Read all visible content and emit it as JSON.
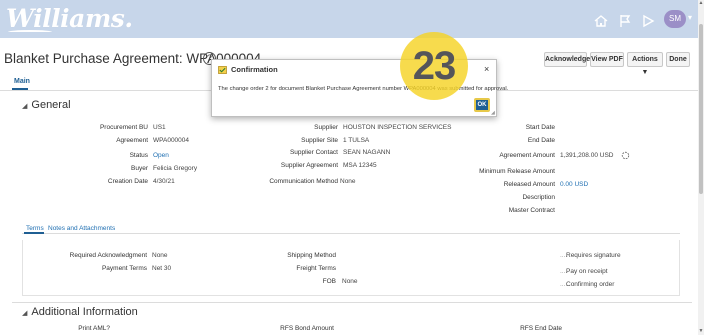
{
  "app": {
    "logo": "Williams.",
    "user_initials": "SM"
  },
  "page": {
    "title": "Blanket Purchase Agreement: WPA000004",
    "buttons": {
      "acknowledge": "Acknowledge",
      "view_pdf": "View PDF",
      "actions": "Actions ▼",
      "done": "Done"
    },
    "main_tab": "Main"
  },
  "general": {
    "title": "General",
    "left": [
      {
        "label": "Procurement BU",
        "value": "US1"
      },
      {
        "label": "Agreement",
        "value": "WPA000004"
      },
      {
        "label": "Status",
        "value": "Open"
      },
      {
        "label": "Buyer",
        "value": "Felicia Gregory"
      },
      {
        "label": "Creation Date",
        "value": "4/30/21"
      }
    ],
    "middle": [
      {
        "label": "Supplier",
        "value": "HOUSTON INSPECTION SERVICES"
      },
      {
        "label": "Supplier Site",
        "value": "1 TULSA"
      },
      {
        "label": "Supplier Contact",
        "value": "SEAN NAGANN"
      },
      {
        "label": "Supplier Agreement",
        "value": "MSA 12345"
      },
      {
        "label": "Communication Method",
        "value": "None"
      }
    ],
    "right": [
      {
        "label": "Start Date",
        "value": ""
      },
      {
        "label": "End Date",
        "value": ""
      },
      {
        "label": "Agreement Amount",
        "value": "1,391,208.00 USD"
      },
      {
        "label": "Minimum Release Amount",
        "value": ""
      },
      {
        "label": "Released Amount",
        "value": "0.00 USD"
      },
      {
        "label": "Description",
        "value": ""
      },
      {
        "label": "Master Contract",
        "value": ""
      }
    ]
  },
  "subtabs": [
    "Terms",
    "Notes and Attachments"
  ],
  "terms": {
    "left": [
      {
        "label": "Required Acknowledgment",
        "value": "None"
      },
      {
        "label": "Payment Terms",
        "value": "Net 30"
      }
    ],
    "middle": [
      {
        "label": "Shipping Method",
        "value": ""
      },
      {
        "label": "Freight Terms",
        "value": ""
      },
      {
        "label": "FOB",
        "value": "None"
      }
    ],
    "right": [
      {
        "label": "",
        "value": "Requires signature"
      },
      {
        "label": "",
        "value": "Pay on receipt"
      },
      {
        "label": "",
        "value": "Confirming order"
      }
    ]
  },
  "additional": {
    "title": "Additional Information",
    "fields": [
      "Print AML?",
      "RFS Bond Amount",
      "RFS End Date"
    ]
  },
  "dialog": {
    "title": "Confirmation",
    "message": "The change order 2 for document Blanket Purchase Agreement number WPA000004 was submitted for approval.",
    "ok_label": "OK",
    "close_label": "×"
  },
  "step_badge": "23",
  "colors": {
    "header_bg": "#c7d6ea",
    "accent": "#1f5f93",
    "link": "#1f6fb2",
    "highlight": "#f5d326"
  }
}
